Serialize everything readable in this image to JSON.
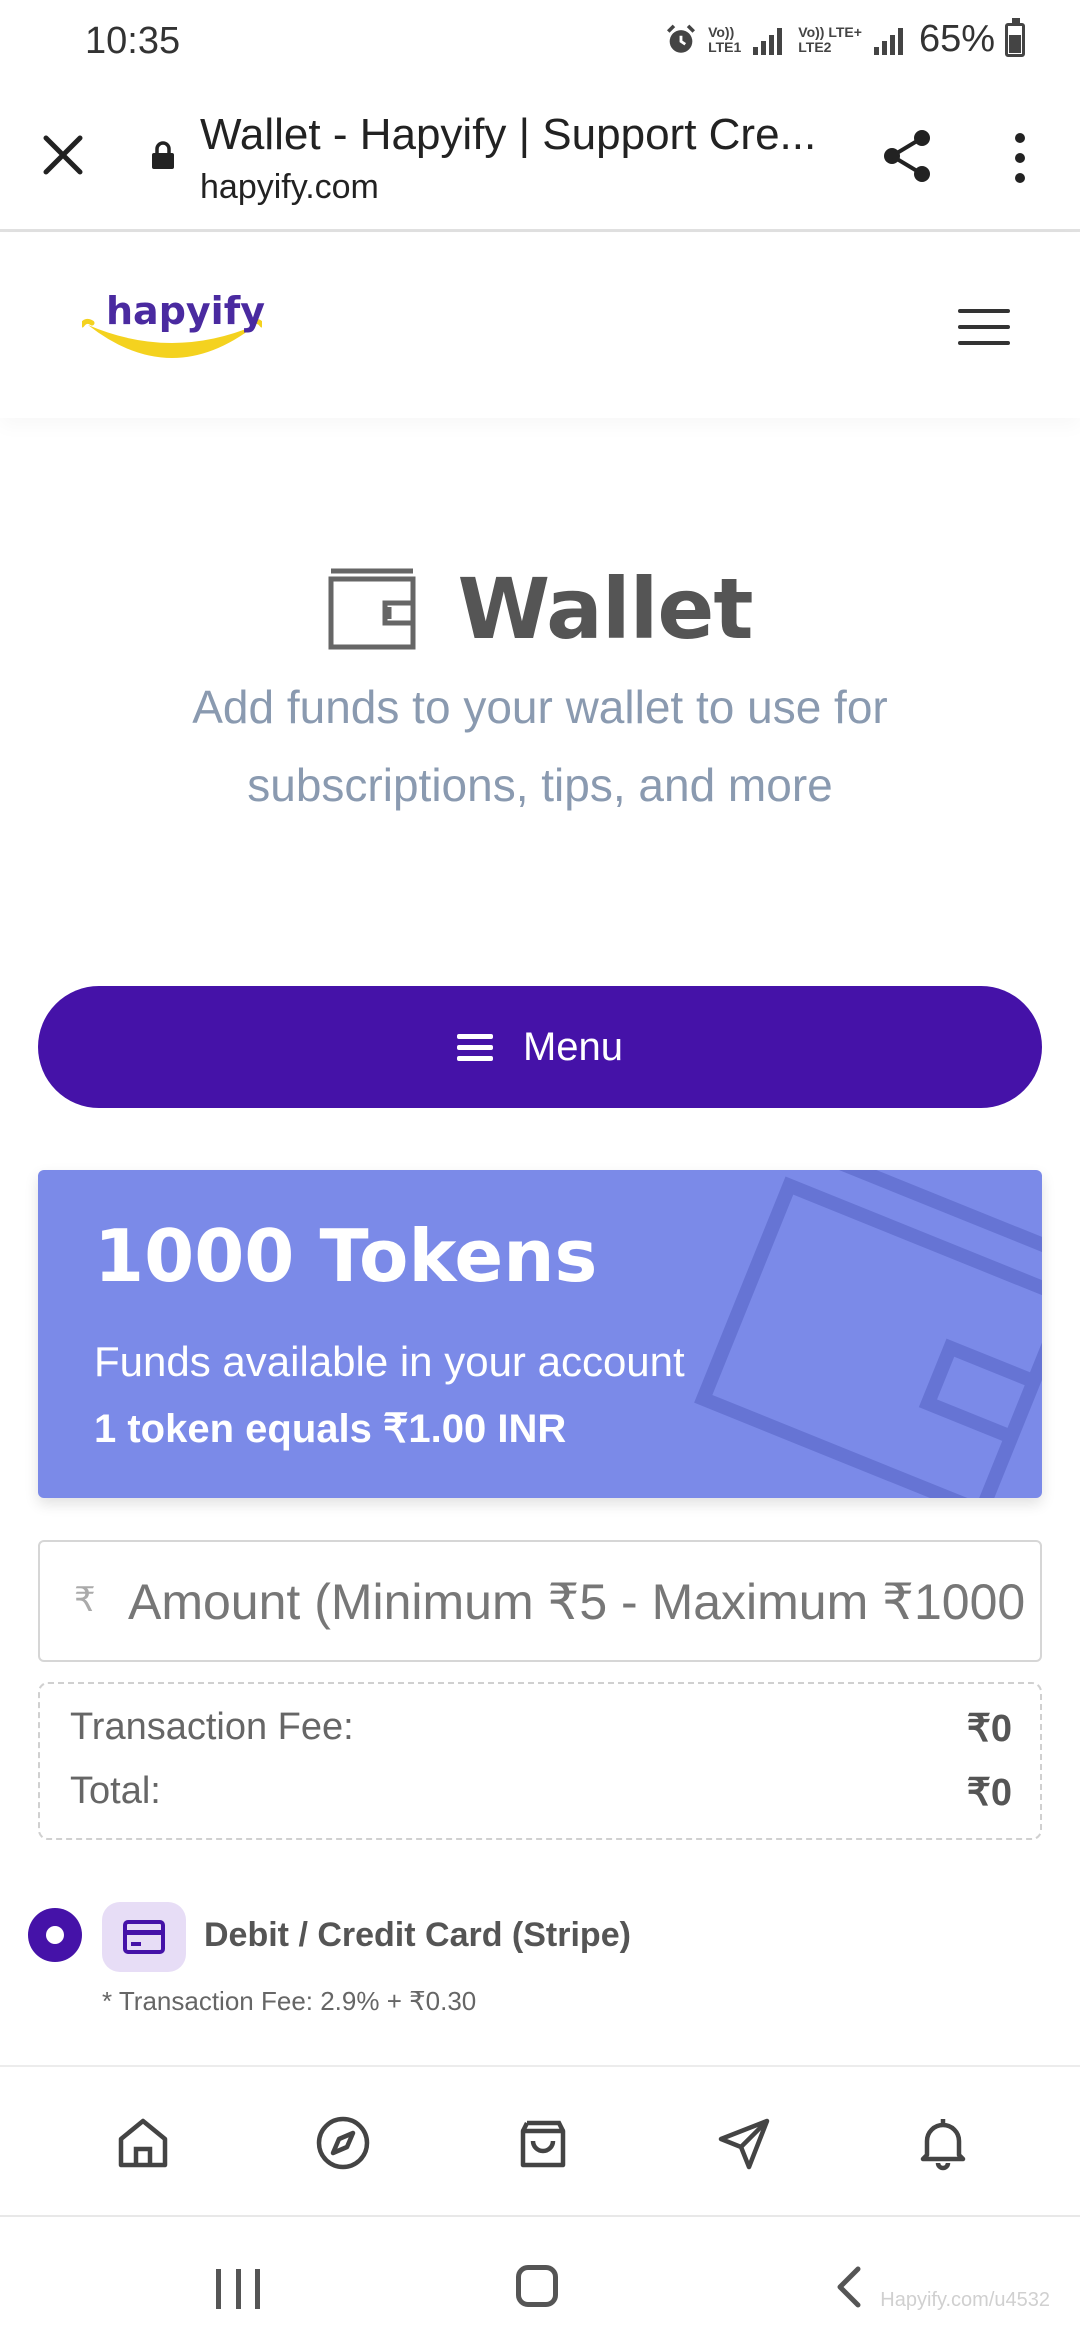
{
  "status_bar": {
    "time": "10:35",
    "network1_top": "Vo))",
    "network1_bottom": "LTE1",
    "network2_top": "Vo)) LTE+",
    "network2_bottom": "LTE2",
    "battery": "65%"
  },
  "browser": {
    "page_title": "Wallet - Hapyify | Support Cre...",
    "domain": "hapyify.com"
  },
  "site": {
    "logo_text": "hapyify",
    "logo_color": "#4a2aa0",
    "smile_color": "#f4d21f"
  },
  "hero": {
    "title": "Wallet",
    "subtitle": "Add funds to your wallet to use for subscriptions, tips, and more"
  },
  "menu_button": {
    "label": "Menu",
    "color": "#4512a8"
  },
  "tokens_card": {
    "balance": "1000 Tokens",
    "funds_label": "Funds available in your account",
    "rate": "1 token equals ₹1.00 INR",
    "color": "#7b8ae8"
  },
  "amount_input": {
    "currency_symbol": "₹",
    "placeholder": "Amount (Minimum ₹5 - Maximum ₹1000",
    "value": ""
  },
  "fees": {
    "transaction_fee_label": "Transaction Fee:",
    "transaction_fee_value": "₹0",
    "total_label": "Total:",
    "total_value": "₹0"
  },
  "payment_option": {
    "label": "Debit / Credit Card (Stripe)",
    "fee_note": "* Transaction Fee: 2.9% + ₹0.30",
    "selected": true
  },
  "tab_bar": {
    "icons": [
      "home-icon",
      "compass-icon",
      "shopping-bag-icon",
      "send-icon",
      "bell-icon"
    ]
  },
  "watermark": "Hapyify.com/u4532"
}
